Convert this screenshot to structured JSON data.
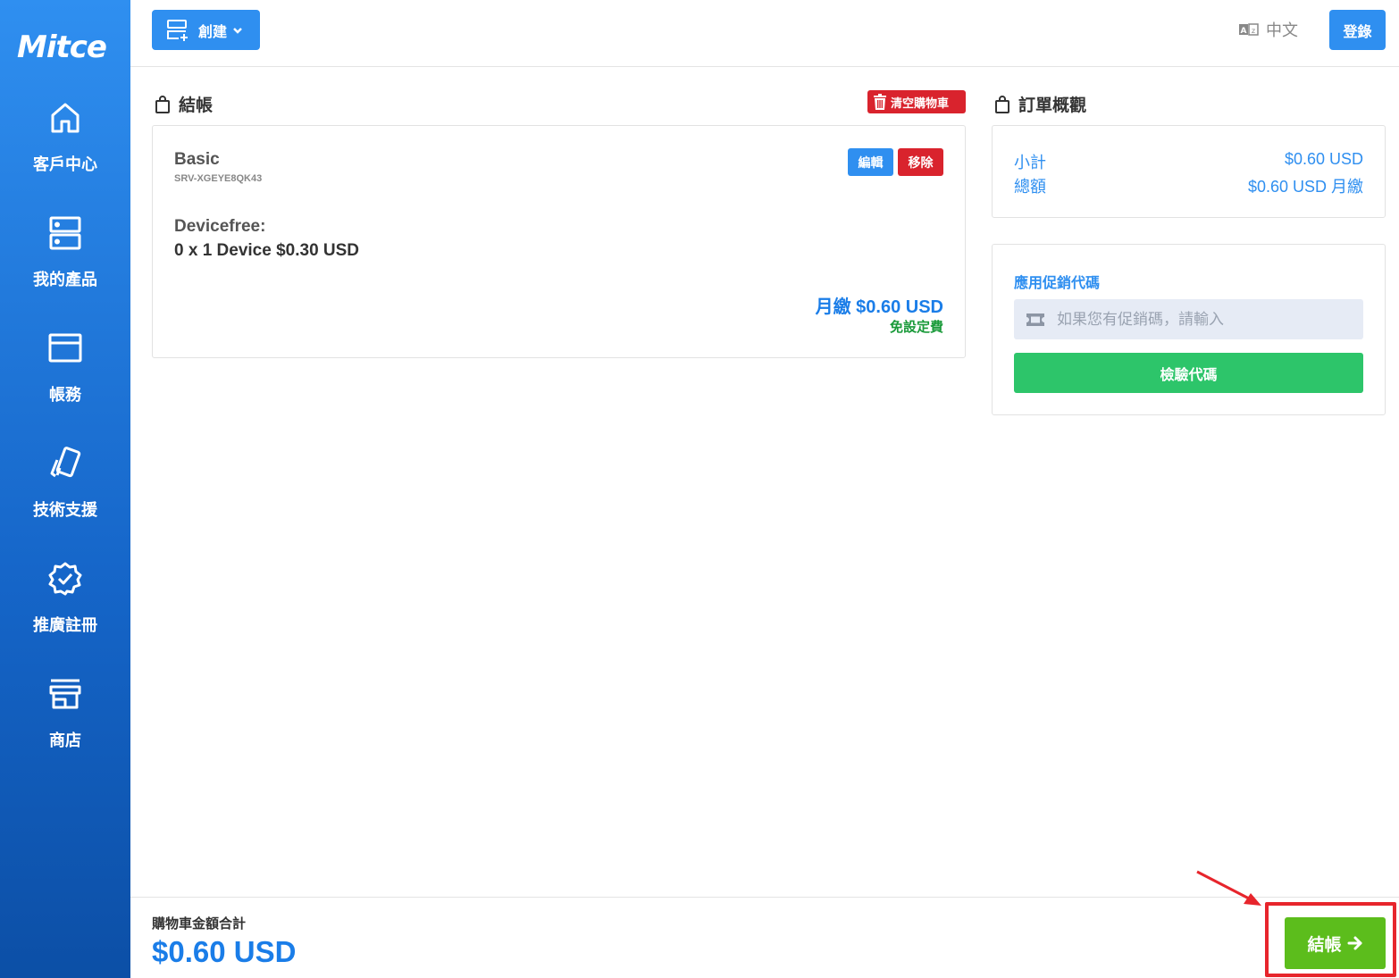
{
  "brand": {
    "logo_text": "Mitce"
  },
  "sidebar": {
    "items": [
      {
        "label": "客戶中心",
        "icon": "home-icon"
      },
      {
        "label": "我的產品",
        "icon": "server-icon"
      },
      {
        "label": "帳務",
        "icon": "credit-card-icon"
      },
      {
        "label": "技術支援",
        "icon": "cards-icon"
      },
      {
        "label": "推廣註冊",
        "icon": "badge-check-icon"
      },
      {
        "label": "商店",
        "icon": "store-icon"
      }
    ]
  },
  "header": {
    "create_label": "創建",
    "language_label": "中文",
    "login_label": "登錄"
  },
  "checkout": {
    "title": "結帳",
    "clear_cart_label": "清空購物車"
  },
  "product": {
    "name": "Basic",
    "service_id": "SRV-XGEYE8QK43",
    "option_label": "Devicefree:",
    "option_value": "0 x 1 Device $0.30 USD",
    "edit_label": "編輯",
    "remove_label": "移除",
    "price": "月繳 $0.60 USD",
    "setup_fee": "免設定費"
  },
  "summary": {
    "title": "訂單概觀",
    "subtotal_label": "小計",
    "subtotal_value": "$0.60 USD",
    "total_label": "總額",
    "total_value": "$0.60 USD 月繳"
  },
  "promo": {
    "title": "應用促銷代碼",
    "placeholder": "如果您有促銷碼，請輸入",
    "verify_label": "檢驗代碼"
  },
  "footer": {
    "total_label": "購物車金額合計",
    "total_value": "$0.60 USD",
    "checkout_label": "結帳"
  },
  "colors": {
    "primary": "#2f8ff0",
    "danger": "#d9232d",
    "success": "#2dc56a",
    "checkout": "#5cbd1c",
    "annotation": "#e7252c"
  }
}
